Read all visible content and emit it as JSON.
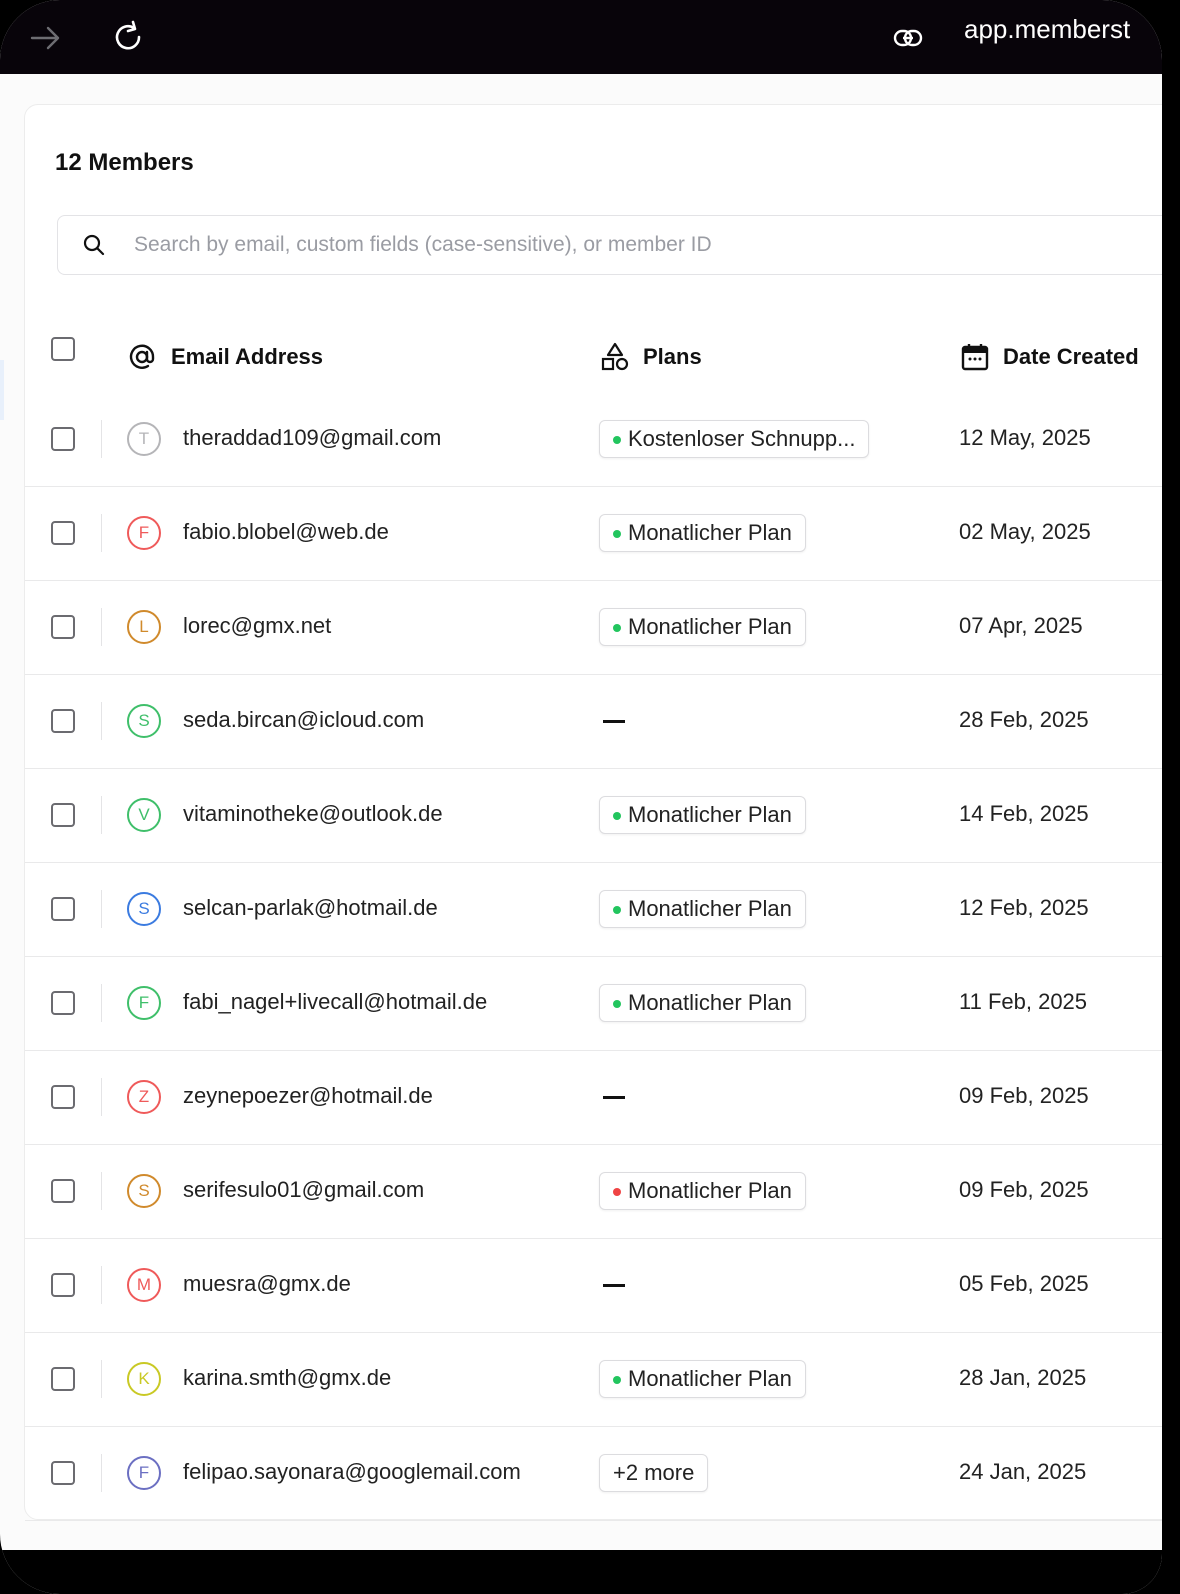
{
  "browser": {
    "url": "app.memberst",
    "icons": [
      "arrow-right-icon",
      "refresh-icon",
      "link-icon"
    ]
  },
  "members": {
    "title": "12 Members",
    "search_placeholder": "Search by email, custom fields (case-sensitive), or member ID",
    "columns": {
      "email": "Email Address",
      "plans": "Plans",
      "date": "Date Created"
    },
    "colors": {
      "active_dot": "#22c55e",
      "inactive_dot": "#ef4444"
    },
    "rows": [
      {
        "initial": "T",
        "color": "#b5b5b8",
        "email": "theraddad109@gmail.com",
        "plan": "Kostenloser Schnupp...",
        "plan_status": "active",
        "date": "12 May, 2025"
      },
      {
        "initial": "F",
        "color": "#ef5a5a",
        "email": "fabio.blobel@web.de",
        "plan": "Monatlicher Plan",
        "plan_status": "active",
        "date": "02 May, 2025"
      },
      {
        "initial": "L",
        "color": "#d08a2c",
        "email": "lorec@gmx.net",
        "plan": "Monatlicher Plan",
        "plan_status": "active",
        "date": "07 Apr, 2025"
      },
      {
        "initial": "S",
        "color": "#3fbf6a",
        "email": "seda.bircan@icloud.com",
        "plan": "—",
        "plan_status": "none",
        "date": "28 Feb, 2025"
      },
      {
        "initial": "V",
        "color": "#3fbf6a",
        "email": "vitaminotheke@outlook.de",
        "plan": "Monatlicher Plan",
        "plan_status": "active",
        "date": "14 Feb, 2025"
      },
      {
        "initial": "S",
        "color": "#3b7be0",
        "email": "selcan-parlak@hotmail.de",
        "plan": "Monatlicher Plan",
        "plan_status": "active",
        "date": "12 Feb, 2025"
      },
      {
        "initial": "F",
        "color": "#3fbf6a",
        "email": "fabi_nagel+livecall@hotmail.de",
        "plan": "Monatlicher Plan",
        "plan_status": "active",
        "date": "11 Feb, 2025"
      },
      {
        "initial": "Z",
        "color": "#ef5a5a",
        "email": "zeynepoezer@hotmail.de",
        "plan": "—",
        "plan_status": "none",
        "date": "09 Feb, 2025"
      },
      {
        "initial": "S",
        "color": "#d08a2c",
        "email": "serifesulo01@gmail.com",
        "plan": "Monatlicher Plan",
        "plan_status": "inactive",
        "date": "09 Feb, 2025"
      },
      {
        "initial": "M",
        "color": "#ef5a5a",
        "email": "muesra@gmx.de",
        "plan": "—",
        "plan_status": "none",
        "date": "05 Feb, 2025"
      },
      {
        "initial": "K",
        "color": "#c9c925",
        "email": "karina.smth@gmx.de",
        "plan": "Monatlicher Plan",
        "plan_status": "active",
        "date": "28 Jan, 2025"
      },
      {
        "initial": "F",
        "color": "#6b6fc2",
        "email": "felipao.sayonara@googlemail.com",
        "plan": "+2 more",
        "plan_status": "more",
        "date": "24 Jan, 2025"
      }
    ]
  }
}
